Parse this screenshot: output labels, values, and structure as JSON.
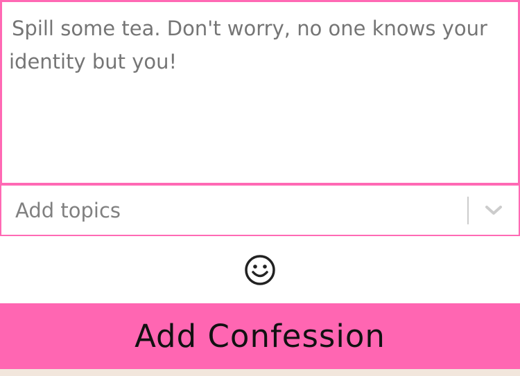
{
  "confession_form": {
    "textarea_placeholder": "Spill some tea. Don't worry, no one knows your identity but you!",
    "topics_placeholder": "Add topics",
    "emoji_icon": "smiley-face-icon",
    "chevron_icon": "chevron-down-icon",
    "submit_label": "Add Confession"
  },
  "colors": {
    "accent": "#ff69b4",
    "button_bg": "#ff66b2",
    "placeholder_text": "#6b7280",
    "footer_strip": "#f2e6dc"
  }
}
